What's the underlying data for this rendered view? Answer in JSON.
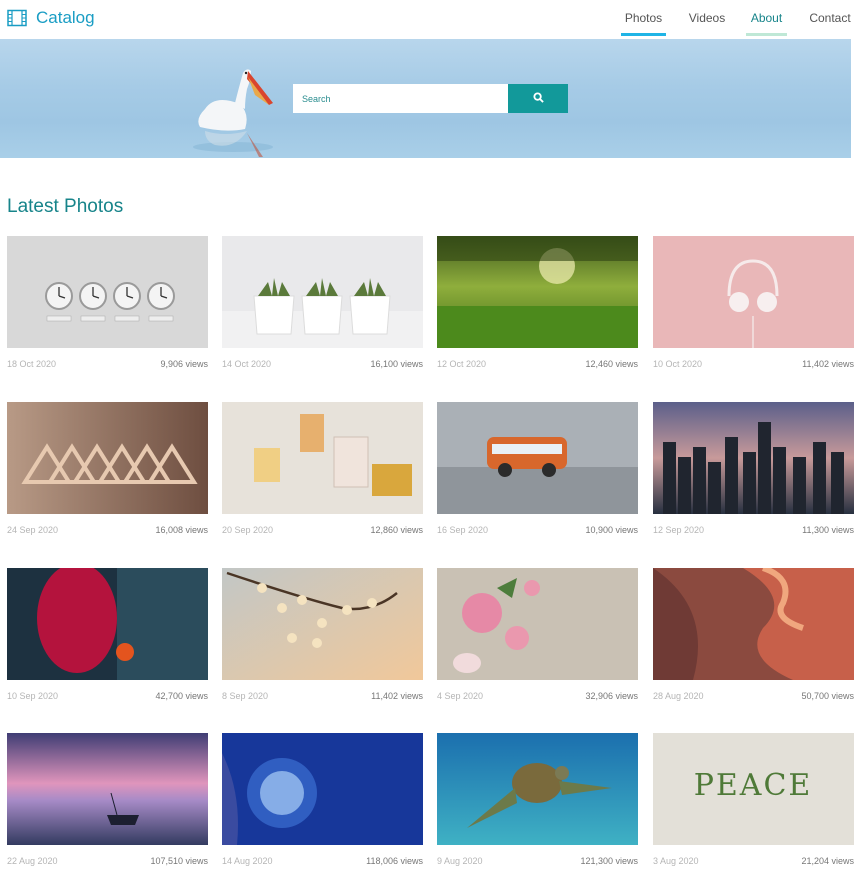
{
  "brand": {
    "name": "Catalog",
    "icon": "film-icon"
  },
  "nav": [
    {
      "label": "Photos",
      "active": true
    },
    {
      "label": "Videos",
      "active": false
    },
    {
      "label": "About",
      "active": false
    },
    {
      "label": "Contact",
      "active": false
    }
  ],
  "search": {
    "placeholder": "Search",
    "button_icon": "search-icon"
  },
  "section_title": "Latest Photos",
  "colors": {
    "accent": "#12999a",
    "brand": "#1a9dc4",
    "title": "#17848a"
  },
  "photos": [
    {
      "date": "18 Oct 2020",
      "views": "9,906 views",
      "subject": "world clocks"
    },
    {
      "date": "14 Oct 2020",
      "views": "16,100 views",
      "subject": "succulents"
    },
    {
      "date": "12 Oct 2020",
      "views": "12,460 views",
      "subject": "forest grass"
    },
    {
      "date": "10 Oct 2020",
      "views": "11,402 views",
      "subject": "headphones"
    },
    {
      "date": "24 Sep 2020",
      "views": "16,008 views",
      "subject": "hangers"
    },
    {
      "date": "20 Sep 2020",
      "views": "12,860 views",
      "subject": "perfumes"
    },
    {
      "date": "16 Sep 2020",
      "views": "10,900 views",
      "subject": "toy bus"
    },
    {
      "date": "12 Sep 2020",
      "views": "11,300 views",
      "subject": "city night"
    },
    {
      "date": "10 Sep 2020",
      "views": "42,700 views",
      "subject": "red abstract"
    },
    {
      "date": "8 Sep 2020",
      "views": "11,402 views",
      "subject": "blossom branch"
    },
    {
      "date": "4 Sep 2020",
      "views": "32,906 views",
      "subject": "pink roses"
    },
    {
      "date": "28 Aug 2020",
      "views": "50,700 views",
      "subject": "canyon"
    },
    {
      "date": "22 Aug 2020",
      "views": "107,510 views",
      "subject": "sunset boat"
    },
    {
      "date": "14 Aug 2020",
      "views": "118,006 views",
      "subject": "coral"
    },
    {
      "date": "9 Aug 2020",
      "views": "121,300 views",
      "subject": "sea turtle"
    },
    {
      "date": "3 Aug 2020",
      "views": "21,204 views",
      "subject": "peace flowers"
    }
  ]
}
